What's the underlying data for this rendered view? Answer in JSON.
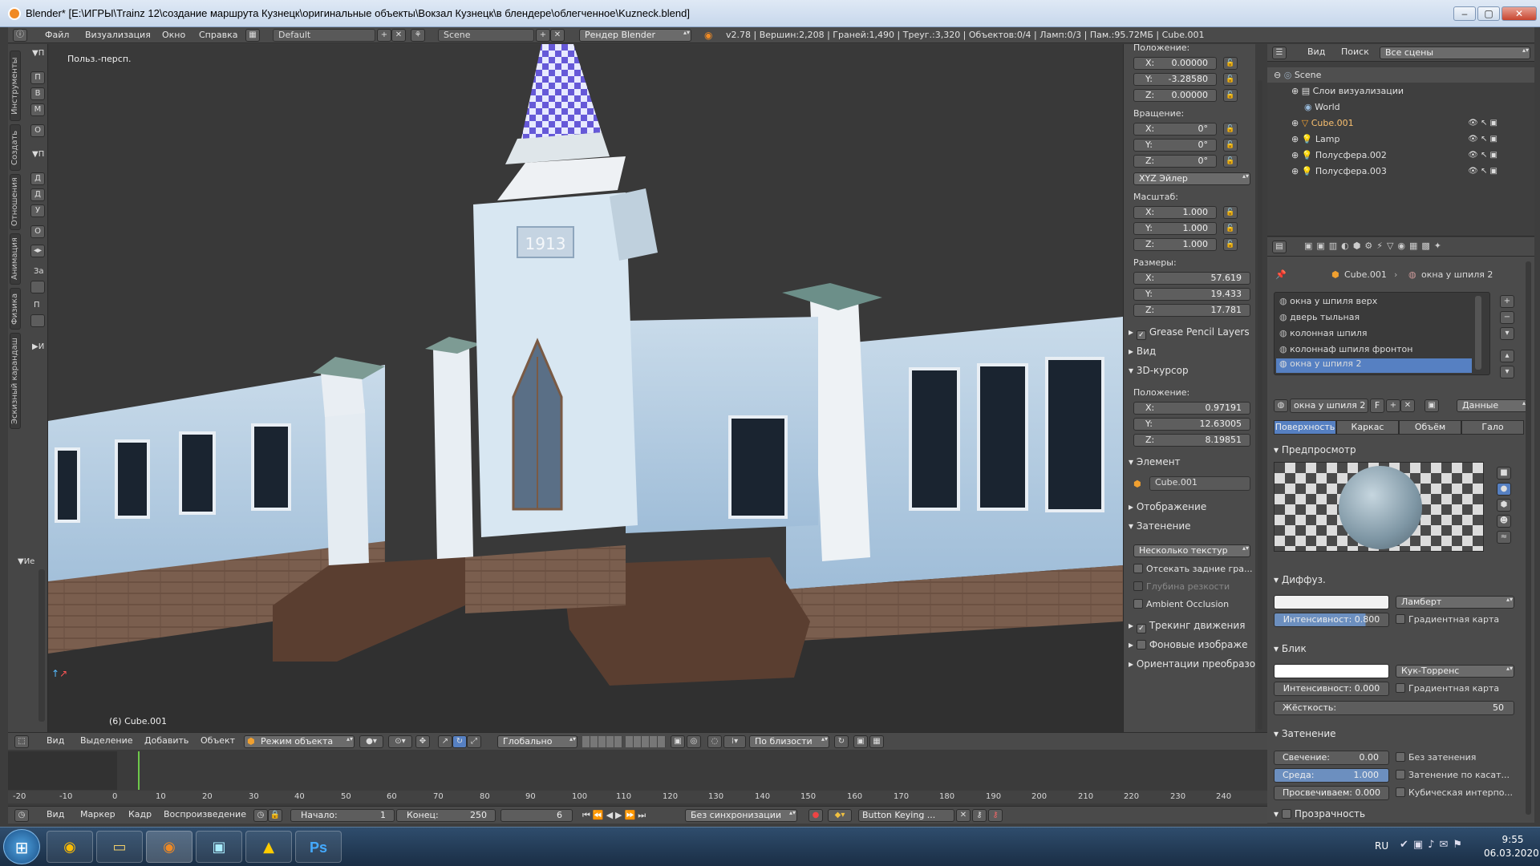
{
  "window": {
    "title": "Blender* [E:\\ИГРЫ\\Trainz 12\\создание маршрута Кузнецк\\оригинальные объекты\\Вокзал Кузнецк\\в блендере\\облегченное\\Kuzneck.blend]",
    "controls": [
      "–",
      "▢",
      "✕"
    ]
  },
  "infobar": {
    "menus": [
      "Файл",
      "Визуализация",
      "Окно",
      "Справка"
    ],
    "layout": "Default",
    "scene": "Scene",
    "engine": "Рендер Blender",
    "stats": "v2.78 | Вершин:2,208 | Граней:1,490 | Треуг.:3,320 | Объектов:0/4 | Ламп:0/3 | Пам.:95.72МБ | Cube.001"
  },
  "left_toolbar": {
    "tabs": [
      "Инструменты",
      "Создать",
      "Отношения",
      "Анимация",
      "Физика",
      "Эскизный карандаш"
    ],
    "buttons": [
      "П",
      "В",
      "М",
      "О",
      "Д",
      "Д",
      "У",
      "О",
      "За",
      "П"
    ],
    "section_markers": [
      "▼П",
      "▼П",
      "▶И",
      "▼Ие"
    ]
  },
  "viewport": {
    "view_label": "Польз.-персп.",
    "object_label": "(6) Cube.001",
    "date_plate": "1913"
  },
  "npanel": {
    "location_label": "Положение:",
    "location": [
      {
        "k": "X:",
        "v": "0.00000"
      },
      {
        "k": "Y:",
        "v": "-3.28580"
      },
      {
        "k": "Z:",
        "v": "0.00000"
      }
    ],
    "rotation_label": "Вращение:",
    "rotation": [
      {
        "k": "X:",
        "v": "0°"
      },
      {
        "k": "Y:",
        "v": "0°"
      },
      {
        "k": "Z:",
        "v": "0°"
      }
    ],
    "rotation_mode": "XYZ Эйлер",
    "scale_label": "Масштаб:",
    "scale": [
      {
        "k": "X:",
        "v": "1.000"
      },
      {
        "k": "Y:",
        "v": "1.000"
      },
      {
        "k": "Z:",
        "v": "1.000"
      }
    ],
    "dims_label": "Размеры:",
    "dims": [
      {
        "k": "X:",
        "v": "57.619"
      },
      {
        "k": "Y:",
        "v": "19.433"
      },
      {
        "k": "Z:",
        "v": "17.781"
      }
    ],
    "grease_pencil": "Grease Pencil Layers",
    "view": "Вид",
    "cursor": "3D-курсор",
    "cursor_label": "Положение:",
    "cursor_loc": [
      {
        "k": "X:",
        "v": "0.97191"
      },
      {
        "k": "Y:",
        "v": "12.63005"
      },
      {
        "k": "Z:",
        "v": "8.19851"
      }
    ],
    "item": "Элемент",
    "item_name": "Cube.001",
    "display": "Отображение",
    "shading": "Затенение",
    "shading_mode": "Несколько текстур",
    "backface": "Отсекать задние гра...",
    "dof": "Глубина резкости",
    "ao": "Ambient Occlusion",
    "motion": "Трекинг движения",
    "bg_images": "Фоновые изображе",
    "orient": "Ориентации преобразо"
  },
  "outliner": {
    "menus": [
      "Вид",
      "Поиск"
    ],
    "filter": "Все сцены",
    "items": [
      {
        "name": "Scene",
        "indent": 0
      },
      {
        "name": "Слои визуализации",
        "indent": 1
      },
      {
        "name": "World",
        "indent": 1
      },
      {
        "name": "Cube.001",
        "indent": 1
      },
      {
        "name": "Lamp",
        "indent": 1
      },
      {
        "name": "Полусфера.002",
        "indent": 1
      },
      {
        "name": "Полусфера.003",
        "indent": 1
      }
    ]
  },
  "props": {
    "breadcrumb_obj": "Cube.001",
    "breadcrumb_mat": "окна у шпиля 2",
    "materials": [
      "окна у шпиля верх",
      "дверь тыльная",
      "колонная шпиля",
      "колоннаф шпиля фронтон",
      "окна у шпиля 2"
    ],
    "selected_material": "окна у шпиля 2",
    "mat_field": "окна у шпиля 2",
    "mat_f": "F",
    "mat_link": "Данные",
    "tabs": [
      "Поверхность",
      "Каркас",
      "Объём",
      "Гало"
    ],
    "preview": "Предпросмотр",
    "diffuse": "Диффуз.",
    "diffuse_shader": "Ламберт",
    "diffuse_intensity": "Интенсивност: 0.800",
    "ramp": "Градиентная карта",
    "specular": "Блик",
    "spec_shader": "Кук-Торренс",
    "spec_intensity": "Интенсивност: 0.000",
    "hardness_label": "Жёсткость:",
    "hardness": "50",
    "shading": "Затенение",
    "emit": "Свечение:",
    "emit_v": "0.00",
    "ambient": "Среда:",
    "ambient_v": "1.000",
    "translucency": "Просвечиваем: 0.000",
    "shadeless": "Без затенения",
    "tangent": "Затенение по касат...",
    "cubic": "Кубическая интерпо...",
    "transparency": "Прозрачность"
  },
  "vp_header": {
    "menus": [
      "Вид",
      "Выделение",
      "Добавить",
      "Объект"
    ],
    "mode": "Режим объекта",
    "orientation": "Глобально",
    "snap": "По близости"
  },
  "timeline": {
    "ticks": [
      "-20",
      "-10",
      "0",
      "10",
      "20",
      "30",
      "40",
      "50",
      "60",
      "70",
      "80",
      "90",
      "100",
      "110",
      "120",
      "130",
      "140",
      "150",
      "160",
      "170",
      "180",
      "190",
      "200",
      "210",
      "220",
      "230",
      "240"
    ],
    "menus": [
      "Вид",
      "Маркер",
      "Кадр",
      "Воспроизведение"
    ],
    "start": "Начало:",
    "start_v": "1",
    "end": "Конец:",
    "end_v": "250",
    "current": "6",
    "sync": "Без синхронизации",
    "keying": "Button Keying ..."
  },
  "taskbar": {
    "lang": "RU",
    "time": "9:55",
    "date": "06.03.2020"
  }
}
